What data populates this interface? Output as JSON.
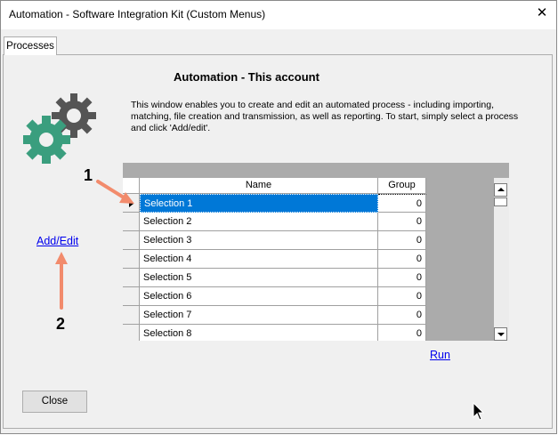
{
  "window": {
    "title": "Automation - Software Integration Kit (Custom Menus)",
    "close_glyph": "✕"
  },
  "tabs": [
    {
      "label": "Processes",
      "active": true
    }
  ],
  "main": {
    "heading": "Automation - This account",
    "description": "This window enables you to create and edit an automated process - including importing, matching, file creation and transmission, as well as reporting.  To start, simply select a process and click 'Add/edit'."
  },
  "grid": {
    "columns": [
      "Name",
      "Group"
    ],
    "rows": [
      {
        "name": "Selection 1",
        "group": "0",
        "selected": true
      },
      {
        "name": "Selection 2",
        "group": "0"
      },
      {
        "name": "Selection 3",
        "group": "0"
      },
      {
        "name": "Selection 4",
        "group": "0"
      },
      {
        "name": "Selection 5",
        "group": "0"
      },
      {
        "name": "Selection 6",
        "group": "0"
      },
      {
        "name": "Selection 7",
        "group": "0"
      },
      {
        "name": "Selection 8",
        "group": "0"
      }
    ]
  },
  "links": {
    "add_edit": "Add/Edit",
    "run": "Run"
  },
  "buttons": {
    "close": "Close"
  },
  "annotations": {
    "one": "1",
    "two": "2",
    "arrow_color": "#f28b6c"
  },
  "colors": {
    "selection": "#0078d7",
    "gear_dark": "#555555",
    "gear_green": "#3a9e7e"
  }
}
